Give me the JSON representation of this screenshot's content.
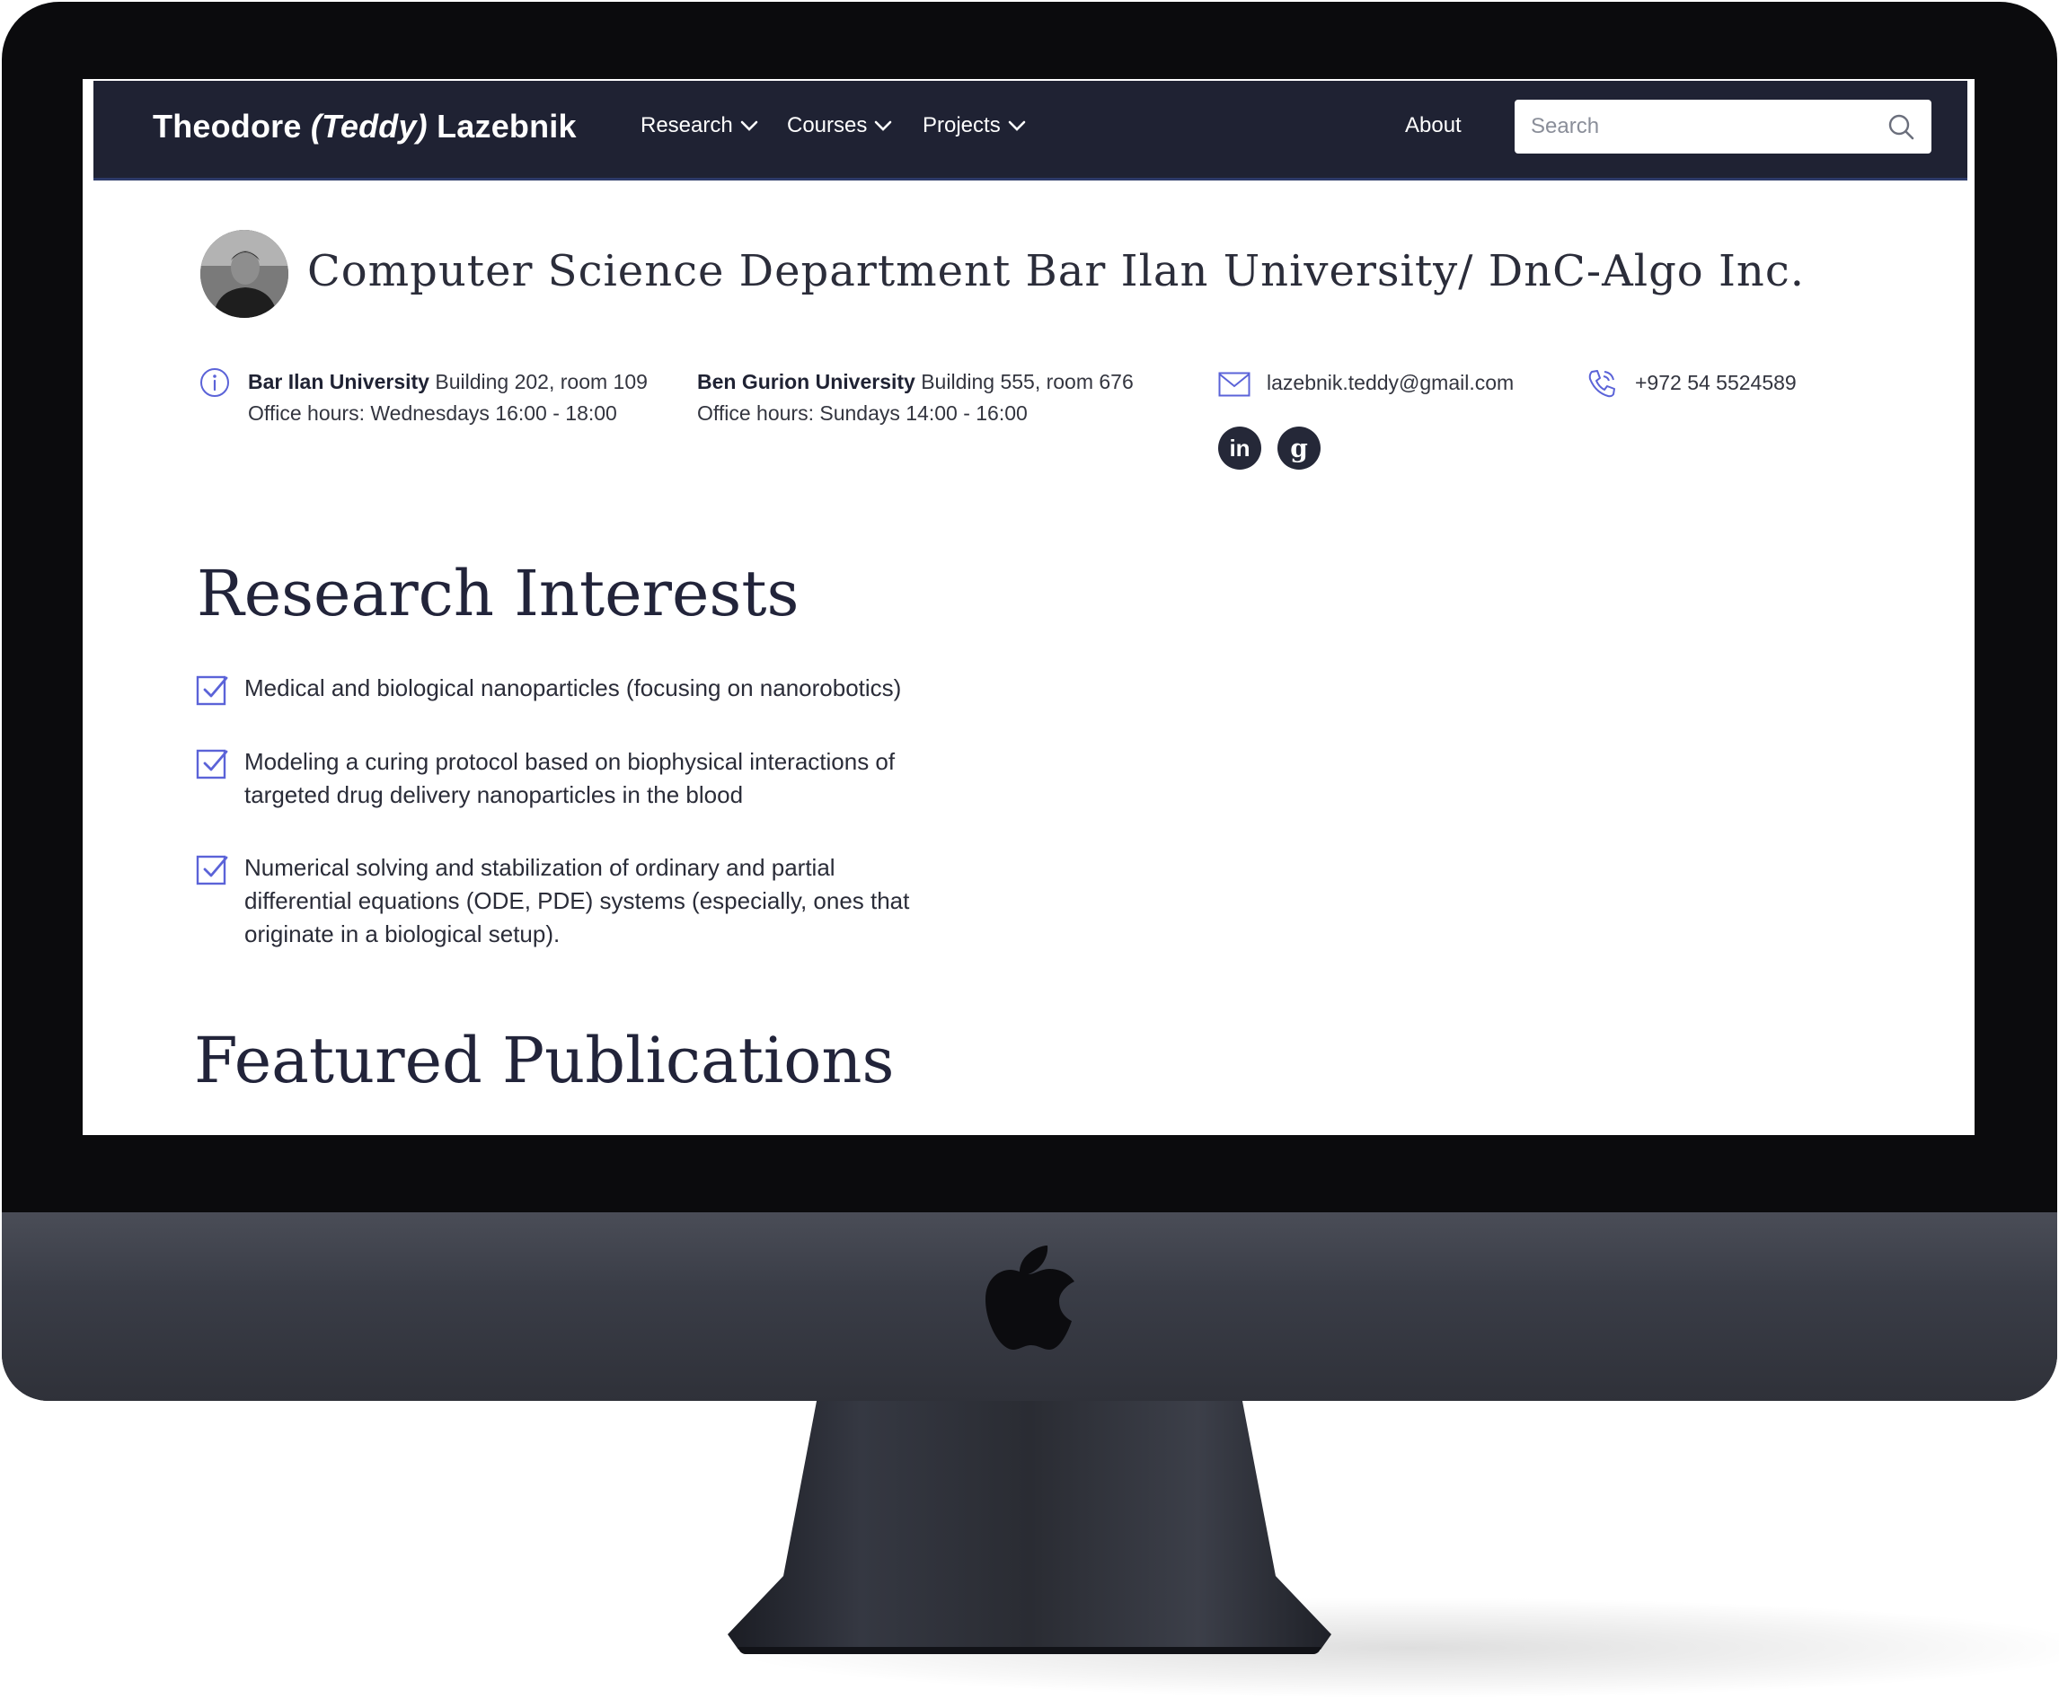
{
  "nav": {
    "brand_first": "Theodore",
    "brand_nick": "(Teddy)",
    "brand_last": "Lazebnik",
    "items": [
      {
        "label": "Research"
      },
      {
        "label": "Courses"
      },
      {
        "label": "Projects"
      }
    ],
    "about": "About",
    "search_placeholder": "Search"
  },
  "profile": {
    "affiliation": "Computer Science Department Bar Ilan University/ DnC-Algo Inc."
  },
  "contacts": {
    "office1": {
      "name": "Bar Ilan University",
      "location": "Building 202, room 109",
      "hours": "Office hours: Wednesdays 16:00 - 18:00"
    },
    "office2": {
      "name": "Ben Gurion University",
      "location": "Building 555, room 676",
      "hours": "Office hours: Sundays 14:00 - 16:00"
    },
    "email": "lazebnik.teddy@gmail.com",
    "phone": "+972 54 5524589",
    "social": {
      "linkedin": "in",
      "google": "g"
    }
  },
  "research": {
    "title": "Research Interests",
    "items": [
      "Medical and biological nanoparticles (focusing on nanorobotics)",
      "Modeling a curing protocol based on biophysical interactions of targeted drug delivery nanoparticles in the blood",
      "Numerical solving and stabilization of ordinary and partial differential equations (ODE, PDE) systems (especially, ones that originate in a biological setup)."
    ]
  },
  "publications": {
    "title": "Featured Publications"
  },
  "colors": {
    "navbar": "#1f2233",
    "accent": "#5b63d8",
    "text": "#2a2c38"
  }
}
